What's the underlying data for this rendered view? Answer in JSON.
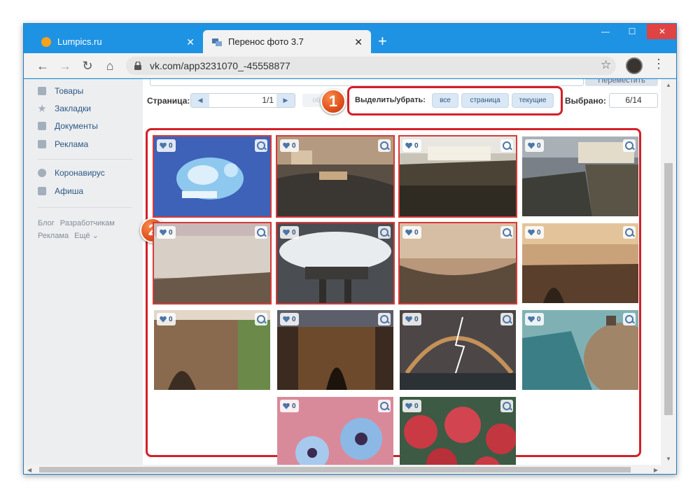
{
  "browser": {
    "tabs": [
      {
        "title": "Lumpics.ru",
        "active": false
      },
      {
        "title": "Перенос фото 3.7",
        "active": true
      }
    ],
    "new_tab": "+",
    "url": "vk.com/app3231070_-45558877",
    "window_controls": {
      "minimize": "—",
      "maximize": "☐",
      "close": "✕"
    }
  },
  "sidebar": {
    "items": [
      {
        "label": "Товары",
        "icon": "bag-icon"
      },
      {
        "label": "Закладки",
        "icon": "star-icon"
      },
      {
        "label": "Документы",
        "icon": "document-icon"
      },
      {
        "label": "Реклама",
        "icon": "megaphone-icon"
      },
      {
        "label": "Коронавирус",
        "icon": "virus-icon"
      },
      {
        "label": "Афиша",
        "icon": "play-icon"
      }
    ],
    "footer": [
      "Блог",
      "Разработчикам",
      "Реклама",
      "Ещё ⌄"
    ]
  },
  "app": {
    "move_button": "Переместить",
    "page_label": "Страница:",
    "page_value": "1/1",
    "faded_button": "об",
    "select_label": "Выделить/убрать:",
    "select_buttons": [
      "все",
      "страница",
      "текущие"
    ],
    "selected_label": "Выбрано:",
    "selected_value": "6/14"
  },
  "callouts": {
    "one": "1",
    "two": "2"
  },
  "colors": {
    "selection": "#d83a3a",
    "callout": "#d42027",
    "badge": "#e0511c",
    "link": "#2a5885"
  },
  "photos": [
    {
      "likes": "0",
      "selected": true,
      "subject": "blue-fish-art"
    },
    {
      "likes": "0",
      "selected": true,
      "subject": "aerial-town-bridge"
    },
    {
      "likes": "0",
      "selected": true,
      "subject": "cliff-white-town"
    },
    {
      "likes": "0",
      "selected": false,
      "subject": "cliff-houses"
    },
    {
      "likes": "0",
      "selected": true,
      "subject": "aerial-white-city"
    },
    {
      "likes": "0",
      "selected": true,
      "subject": "bridge-in-fog"
    },
    {
      "likes": "0",
      "selected": true,
      "subject": "aerial-gorge-town"
    },
    {
      "likes": "0",
      "selected": false,
      "subject": "sunset-bridge"
    },
    {
      "likes": "0",
      "selected": false,
      "subject": "stone-bridge-day"
    },
    {
      "likes": "0",
      "selected": false,
      "subject": "bridge-night"
    },
    {
      "likes": "0",
      "selected": false,
      "subject": "lightning-rainbow"
    },
    {
      "likes": "0",
      "selected": false,
      "subject": "cliff-sea-view"
    },
    {
      "likes": "0",
      "selected": false,
      "subject": "blue-daisies"
    },
    {
      "likes": "0",
      "selected": false,
      "subject": "red-roses"
    }
  ]
}
